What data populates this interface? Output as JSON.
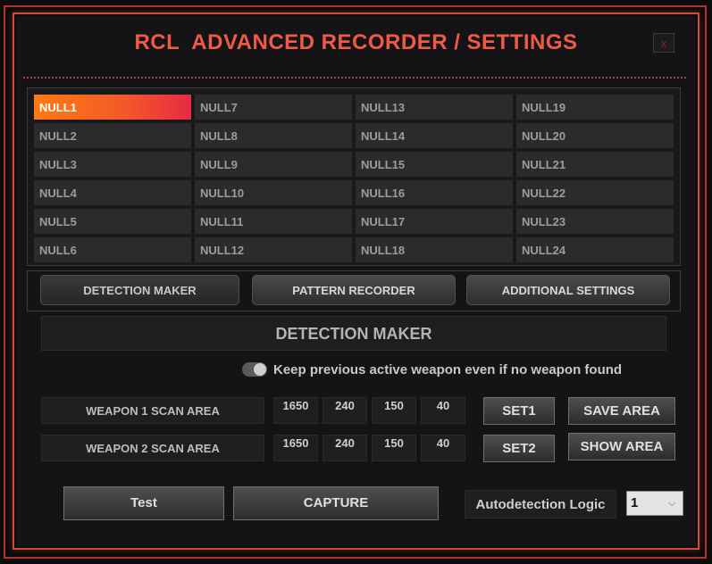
{
  "window": {
    "title": "RCL  ADVANCED RECORDER / SETTINGS",
    "close_label": "x"
  },
  "weapon_slots": [
    {
      "label": "NULL1",
      "active": true
    },
    {
      "label": "NULL2"
    },
    {
      "label": "NULL3"
    },
    {
      "label": "NULL4"
    },
    {
      "label": "NULL5"
    },
    {
      "label": "NULL6"
    },
    {
      "label": "NULL7"
    },
    {
      "label": "NULL8"
    },
    {
      "label": "NULL9"
    },
    {
      "label": "NULL10"
    },
    {
      "label": "NULL11"
    },
    {
      "label": "NULL12"
    },
    {
      "label": "NULL13"
    },
    {
      "label": "NULL14"
    },
    {
      "label": "NULL15"
    },
    {
      "label": "NULL16"
    },
    {
      "label": "NULL17"
    },
    {
      "label": "NULL18"
    },
    {
      "label": "NULL19"
    },
    {
      "label": "NULL20"
    },
    {
      "label": "NULL21"
    },
    {
      "label": "NULL22"
    },
    {
      "label": "NULL23"
    },
    {
      "label": "NULL24"
    }
  ],
  "tabs": [
    {
      "label": "DETECTION MAKER",
      "active": true
    },
    {
      "label": "PATTERN RECORDER"
    },
    {
      "label": "ADDITIONAL SETTINGS"
    }
  ],
  "detection": {
    "section_title": "DETECTION MAKER",
    "keep_weapon_label": "Keep previous active weapon even if no weapon found",
    "keep_weapon_enabled": true,
    "scan_areas": [
      {
        "label": "WEAPON 1 SCAN AREA",
        "values": [
          "1650",
          "240",
          "150",
          "40"
        ],
        "set_label": "SET1"
      },
      {
        "label": "WEAPON 2 SCAN AREA",
        "values": [
          "1650",
          "240",
          "150",
          "40"
        ],
        "set_label": "SET2"
      }
    ],
    "save_area_label": "SAVE AREA",
    "show_area_label": "SHOW AREA",
    "test_label": "Test",
    "capture_label": "CAPTURE",
    "autodetection_label": "Autodetection Logic",
    "autodetection_value": "1"
  },
  "colors": {
    "accent": "#f05a45",
    "frame": "#d14a3e",
    "active_slot_start": "#ff7a12",
    "active_slot_end": "#e72a42"
  }
}
